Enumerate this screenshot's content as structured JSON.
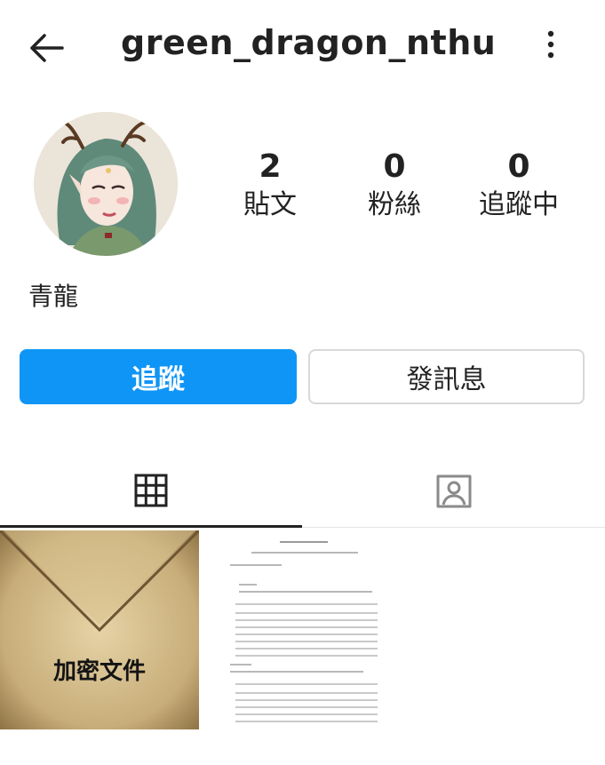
{
  "header": {
    "username": "green_dragon_nthu"
  },
  "profile": {
    "stats": [
      {
        "value": "2",
        "label": "貼文"
      },
      {
        "value": "0",
        "label": "粉絲"
      },
      {
        "value": "0",
        "label": "追蹤中"
      }
    ],
    "display_name": "青龍"
  },
  "actions": {
    "follow_label": "追蹤",
    "message_label": "發訊息"
  },
  "posts": [
    {
      "overlay_text": "加密文件"
    }
  ],
  "colors": {
    "accent": "#0f95f6",
    "text": "#222222"
  }
}
